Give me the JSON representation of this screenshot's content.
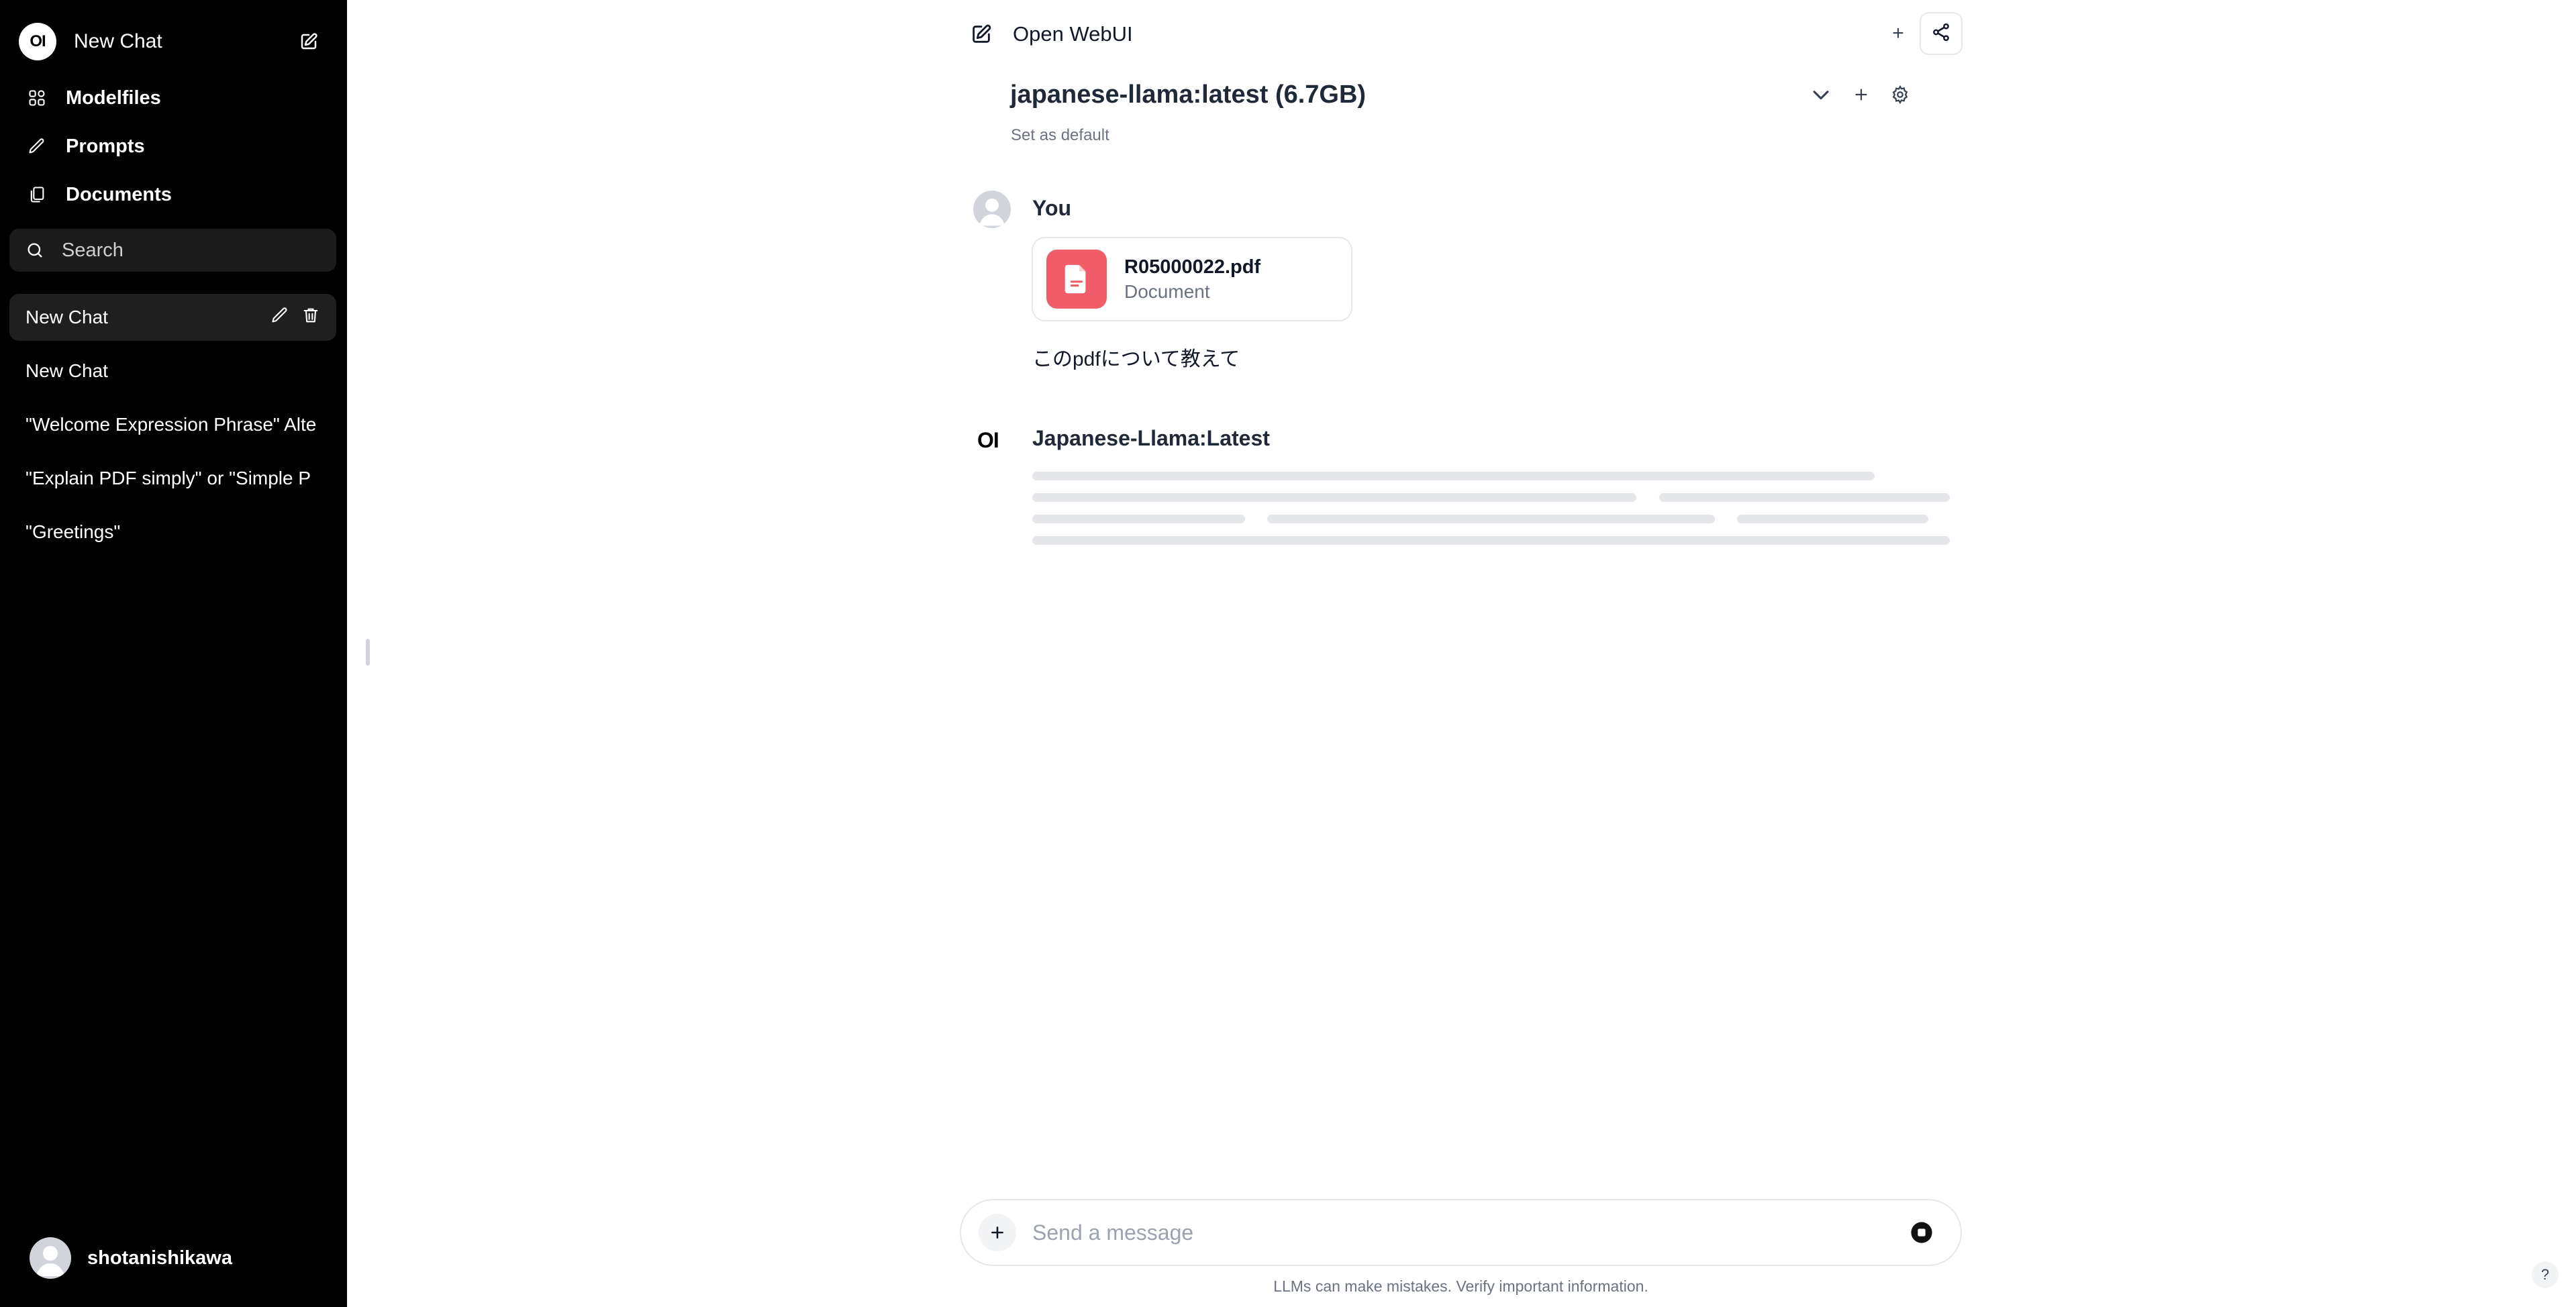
{
  "sidebar": {
    "logo_text": "OI",
    "new_chat_label": "New Chat",
    "nav": [
      {
        "label": "Modelfiles",
        "icon": "modelfiles-icon"
      },
      {
        "label": "Prompts",
        "icon": "pencil-icon"
      },
      {
        "label": "Documents",
        "icon": "documents-icon"
      }
    ],
    "search_placeholder": "Search",
    "chats": [
      {
        "label": "New Chat",
        "active": true
      },
      {
        "label": "New Chat",
        "active": false
      },
      {
        "label": "\"Welcome Expression Phrase\" Alte",
        "active": false
      },
      {
        "label": "\"Explain PDF simply\" or \"Simple P",
        "active": false
      },
      {
        "label": "\"Greetings\"",
        "active": false
      }
    ],
    "user_name": "shotanishikawa"
  },
  "topbar": {
    "title": "Open WebUI",
    "plus_label": "+"
  },
  "model": {
    "name": "japanese-llama:latest (6.7GB)",
    "set_default": "Set as default"
  },
  "messages": {
    "user": {
      "name": "You",
      "file_name": "R05000022.pdf",
      "file_type": "Document",
      "text": "このpdfについて教えて"
    },
    "assistant": {
      "logo_text": "OI",
      "name": "Japanese-Llama:Latest",
      "state": "loading"
    }
  },
  "input": {
    "placeholder": "Send a message",
    "disclaimer": "LLMs can make mistakes. Verify important information."
  },
  "help_label": "?",
  "colors": {
    "sidebar_bg": "#000000",
    "file_icon_bg": "#f15c69",
    "skeleton": "#e5e7eb"
  }
}
